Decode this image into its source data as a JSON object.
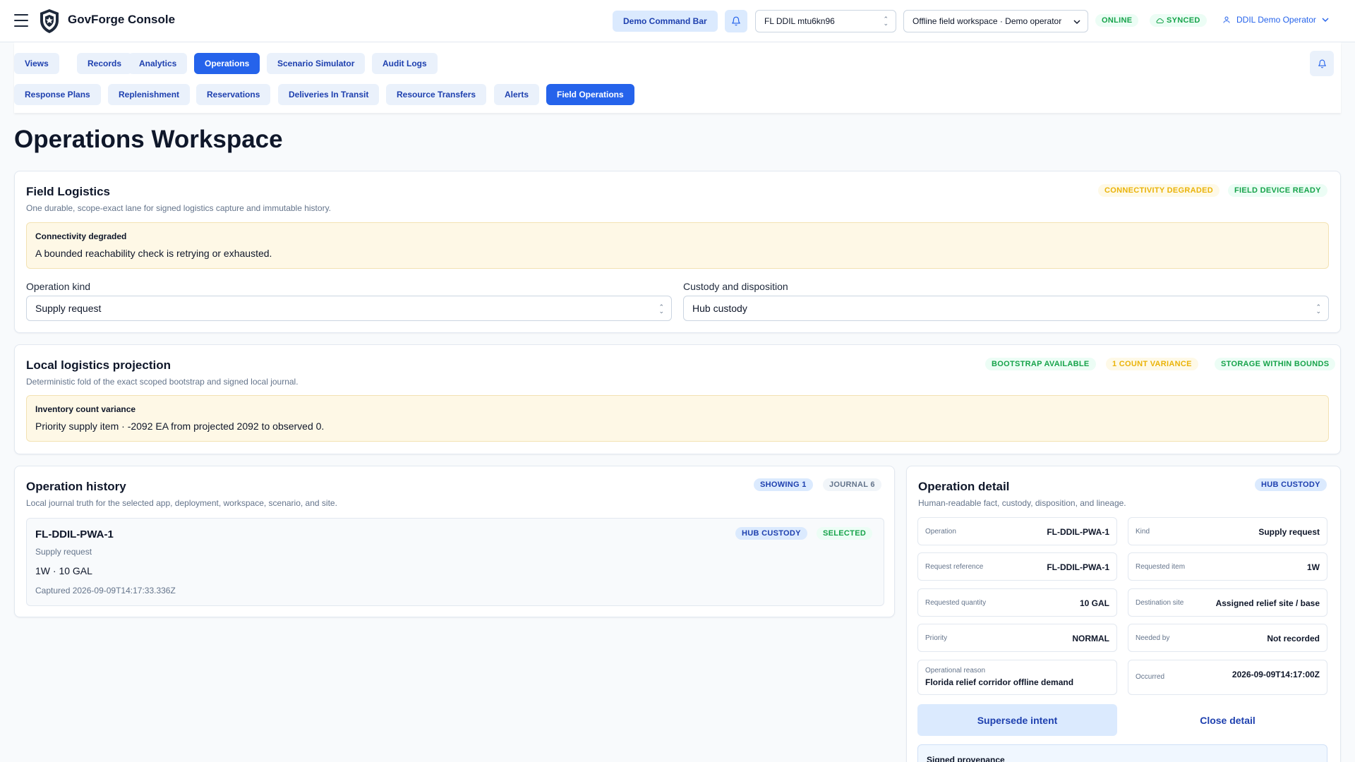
{
  "app": {
    "name": "GovForge Console"
  },
  "topbar": {
    "command_bar": "Demo Command Bar",
    "ddil_select": "FL DDIL mtu6kn96",
    "workspace_select": "Offline field workspace · Demo operator",
    "status_online": "ONLINE",
    "status_synced": "SYNCED",
    "user": "DDIL Demo Operator"
  },
  "nav": {
    "primary_tabs": [
      "Views",
      "Records",
      "Analytics",
      "Operations",
      "Scenario Simulator",
      "Audit Logs"
    ],
    "primary_active": "Operations",
    "secondary_tabs": [
      "Response Plans",
      "Replenishment",
      "Reservations",
      "Deliveries In Transit",
      "Resource Transfers",
      "Alerts",
      "Field Operations"
    ],
    "secondary_active": "Field Operations"
  },
  "page": {
    "title": "Operations Workspace"
  },
  "field_logistics": {
    "title": "Field Logistics",
    "subtitle": "One durable, scope-exact lane for signed logistics capture and immutable history.",
    "badges": [
      "CONNECTIVITY DEGRADED",
      "FIELD DEVICE READY"
    ],
    "notice_title": "Connectivity degraded",
    "notice_body": "A bounded reachability check is retrying or exhausted.",
    "operation_kind_label": "Operation kind",
    "operation_kind_value": "Supply request",
    "custody_label": "Custody and disposition",
    "custody_value": "Hub custody"
  },
  "projection": {
    "title": "Local logistics projection",
    "subtitle": "Deterministic fold of the exact scoped bootstrap and signed local journal.",
    "badges": [
      "BOOTSTRAP AVAILABLE",
      "1 COUNT VARIANCE",
      "STORAGE WITHIN BOUNDS"
    ],
    "notice_title": "Inventory count variance",
    "notice_body": "Priority supply item · -2092 EA from projected 2092 to observed 0."
  },
  "history": {
    "title": "Operation history",
    "subtitle": "Local journal truth for the selected app, deployment, workspace, scenario, and site.",
    "badges": [
      "SHOWING 1",
      "JOURNAL 6"
    ],
    "item": {
      "id": "FL-DDIL-PWA-1",
      "kind": "Supply request",
      "qty": "1W · 10 GAL",
      "captured": "Captured 2026-09-09T14:17:33.336Z",
      "badges": [
        "HUB CUSTODY",
        "SELECTED"
      ]
    }
  },
  "detail": {
    "title": "Operation detail",
    "subtitle": "Human-readable fact, custody, disposition, and lineage.",
    "badge": "HUB CUSTODY",
    "fields": [
      {
        "label": "Operation",
        "value": "FL-DDIL-PWA-1"
      },
      {
        "label": "Kind",
        "value": "Supply request"
      },
      {
        "label": "Request reference",
        "value": "FL-DDIL-PWA-1"
      },
      {
        "label": "Requested item",
        "value": "1W"
      },
      {
        "label": "Requested quantity",
        "value": "10 GAL"
      },
      {
        "label": "Destination site",
        "value": "Assigned relief site / base"
      },
      {
        "label": "Priority",
        "value": "NORMAL"
      },
      {
        "label": "Needed by",
        "value": "Not recorded"
      },
      {
        "label": "Operational reason",
        "value": "Florida relief corridor offline demand"
      },
      {
        "label": "Occurred",
        "value": "2026-09-09T14:17:00Z"
      }
    ],
    "supersede_button": "Supersede intent",
    "close_button": "Close detail",
    "provenance_title": "Signed provenance"
  },
  "colors": {
    "accent": "#2563eb",
    "amber": "#eab308",
    "green": "#16a34a"
  },
  "icons": [
    "menu-icon",
    "shield-logo",
    "bell-icon",
    "user-icon",
    "chevron-down-icon",
    "cloud-check-icon"
  ]
}
